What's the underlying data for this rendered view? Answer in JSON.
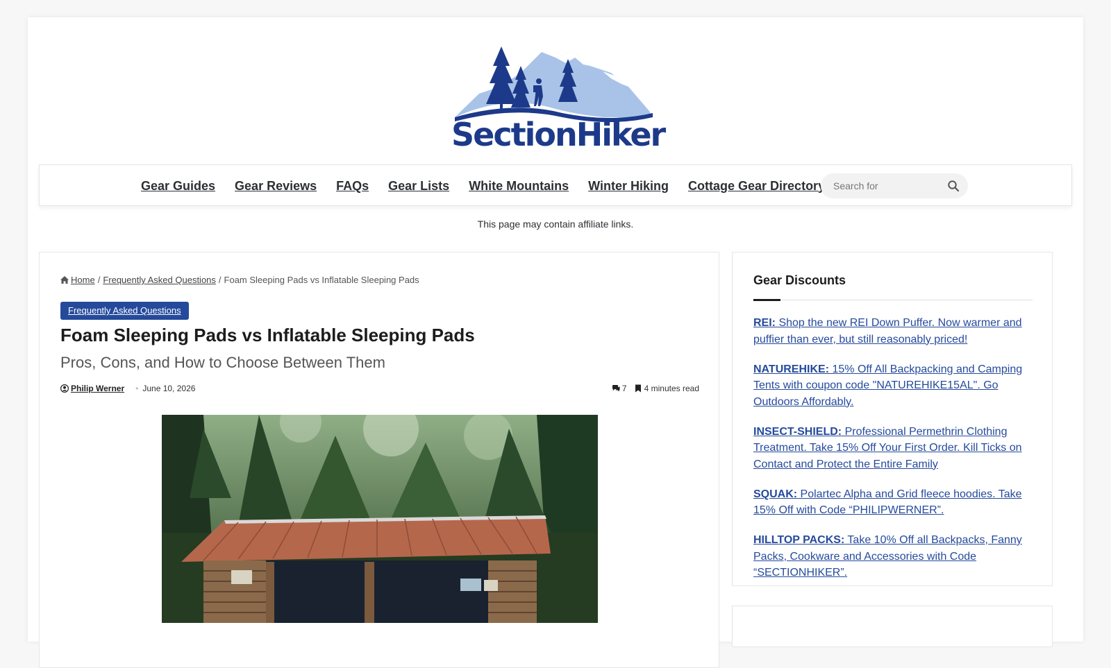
{
  "site": {
    "logo_text": "SectionHiker"
  },
  "nav": {
    "items": [
      {
        "label": "Gear Guides"
      },
      {
        "label": "Gear Reviews"
      },
      {
        "label": "FAQs"
      },
      {
        "label": "Gear Lists"
      },
      {
        "label": "White Mountains"
      },
      {
        "label": "Winter Hiking"
      },
      {
        "label": "Cottage Gear Directory"
      }
    ],
    "search_placeholder": "Search for"
  },
  "affiliate_notice": "This page may contain affiliate links.",
  "breadcrumb": {
    "home": "Home",
    "category": "Frequently Asked Questions",
    "current": "Foam Sleeping Pads vs Inflatable Sleeping Pads",
    "separator": "/"
  },
  "post": {
    "category_badge": "Frequently Asked Questions",
    "title": "Foam Sleeping Pads vs Inflatable Sleeping Pads",
    "subtitle": "Pros, Cons, and How to Choose Between Them",
    "author": "Philip Werner",
    "date": "June 10, 2026",
    "comments": "7",
    "read_time": "4 minutes read"
  },
  "sidebar": {
    "title": "Gear Discounts",
    "deals": [
      {
        "brand": "REI:",
        "text": " Shop the new REI Down Puffer. Now warmer and puffier than ever, but still reasonably priced!"
      },
      {
        "brand": "NATUREHIKE:",
        "text": " 15% Off All Backpacking and Camping Tents with coupon code \"NATUREHIKE15AL\". Go Outdoors Affordably."
      },
      {
        "brand": "INSECT-SHIELD:",
        "text": " Professional Permethrin Clothing Treatment. Take 15% Off Your First Order. Kill Ticks on Contact and Protect the Entire Family"
      },
      {
        "brand": "SQUAK:",
        "text": " Polartec Alpha and Grid fleece hoodies. Take 15% Off with Code “PHILIPWERNER”."
      },
      {
        "brand": "HILLTOP PACKS:",
        "text": " Take 10% Off all Backpacks, Fanny Packs, Cookware and Accessories with Code “SECTIONHIKER”."
      }
    ]
  },
  "colors": {
    "accent": "#254a9c",
    "text": "#2c2f34",
    "background": "#f7f7f7"
  },
  "icons": [
    "search-icon",
    "home-icon",
    "user-icon",
    "comments-icon",
    "bookmark-icon"
  ]
}
